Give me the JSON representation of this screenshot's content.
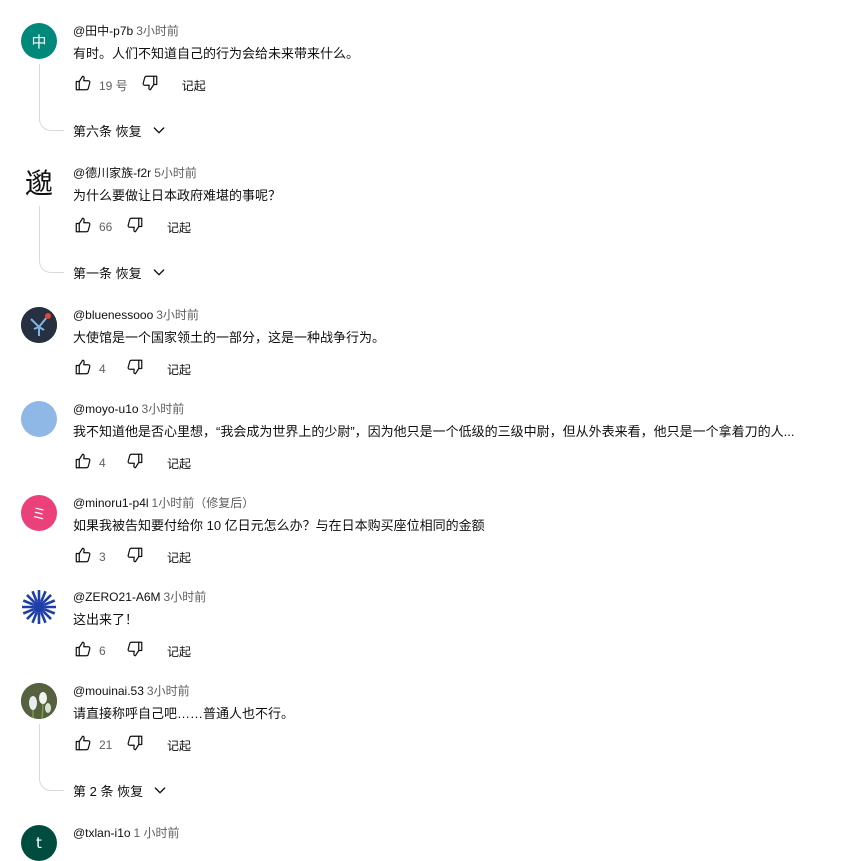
{
  "labels": {
    "reply": "记起"
  },
  "colors": {
    "av_tanaka": "#00897b",
    "av_minoru": "#ec407a",
    "av_moyo": "#8fb8e6",
    "av_txlan": "#004d40"
  },
  "comments": [
    {
      "author": "@田中-p7b",
      "time": "3小时前",
      "text": "有时。人们不知道自己的行为会给未来带来什么。",
      "likes": "19 号",
      "avatar_letter": "中",
      "replies": "第六条 恢复"
    },
    {
      "author": "@德川家族-f2r",
      "time": "5小时前",
      "text": "为什么要做让日本政府难堪的事呢？",
      "likes": "66",
      "replies": "第一条 恢复"
    },
    {
      "author": "@bluenessooo",
      "time": "3小时前",
      "text": "大使馆是一个国家领土的一部分，这是一种战争行为。",
      "likes": "4"
    },
    {
      "author": "@moyo-u1o",
      "time": "3小时前",
      "text": "我不知道他是否心里想，“我会成为世界上的少尉”，因为他只是一个低级的三级中尉，但从外表来看，他只是一个拿着刀的人...",
      "likes": "4"
    },
    {
      "author": "@minoru1-p4l",
      "time": "1小时前（修复后）",
      "text": "如果我被告知要付给你 10 亿日元怎么办？与在日本购买座位相同的金额",
      "likes": "3",
      "avatar_letter": "ミ"
    },
    {
      "author": "@ZERO21-A6M",
      "time": "3小时前",
      "text": "这出来了！",
      "likes": "6"
    },
    {
      "author": "@mouinai.53",
      "time": "3小时前",
      "text": "请直接称呼自己吧……普通人也不行。",
      "likes": "21",
      "replies": "第 2 条 恢复"
    },
    {
      "author": "@txlan-i1o",
      "time": "1 小时前",
      "avatar_letter": "t"
    }
  ]
}
